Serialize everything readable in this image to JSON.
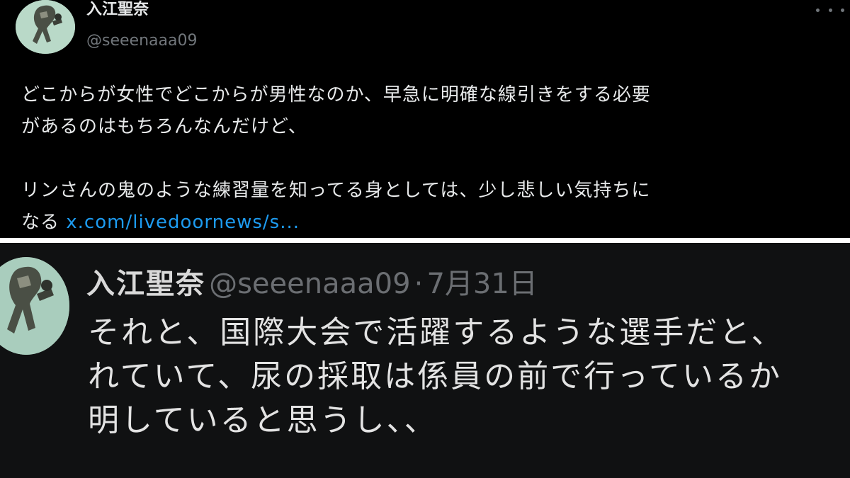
{
  "top_tweet": {
    "author_name": "入江聖奈",
    "author_handle": "@seeenaaa09",
    "body_lines": [
      "どこからが女性でどこからが男性なのか、早急に明確な線引きをする必要",
      "があるのはもちろんなんだけど、",
      "リンさんの鬼のような練習量を知ってる身としては、少し悲しい気持ちに"
    ],
    "last_line_text": "なる",
    "link_text": "x.com/livedoornews/s..."
  },
  "bottom_tweet": {
    "author_name": "入江聖奈",
    "author_handle": "@seeenaaa09",
    "separator": "·",
    "date": "7月31日",
    "body_lines": [
      "それと、国際大会で活躍するような選手だと、",
      "れていて、尿の採取は係員の前で行っているか",
      "明していると思うし、、"
    ]
  },
  "colors": {
    "background_top": "#000000",
    "background_bottom": "#101112",
    "text_primary": "#e7e9ea",
    "text_secondary": "#71767b",
    "link": "#1d9bf0",
    "divider": "#ffffff"
  },
  "icons": {
    "more": "more-horizontal-icon",
    "avatar": "avatar-illustration"
  }
}
